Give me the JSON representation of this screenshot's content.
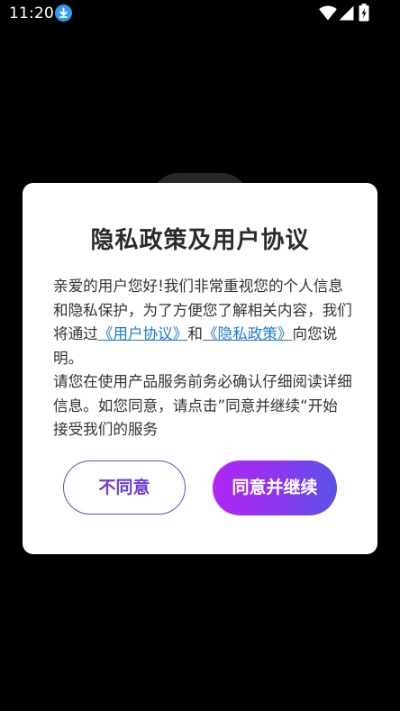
{
  "status_bar": {
    "time": "11:20",
    "icons": [
      "download-icon",
      "wifi-icon",
      "signal-icon",
      "battery-charging-icon"
    ]
  },
  "dialog": {
    "title": "隐私政策及用户协议",
    "paragraph1_before": "亲爱的用户您好!我们非常重视您的个人信息和隐私保护，为了方便您了解相关内容，我们将通过",
    "user_agreement_link": "《用户协议》",
    "connector": "和",
    "privacy_policy_link": "《隐私政策》",
    "paragraph1_after": "向您说明。",
    "paragraph2": "请您在使用产品服务前务必确认仔细阅读详细信息。如您同意，请点击”同意并继续“开始接受我们的服务",
    "decline_label": "不同意",
    "accept_label": "同意并继续"
  },
  "colors": {
    "link": "#1e7ad8",
    "decline_text": "#6f3fd1",
    "accept_gradient_start": "#b126f2",
    "accept_gradient_end": "#5a52e6"
  }
}
